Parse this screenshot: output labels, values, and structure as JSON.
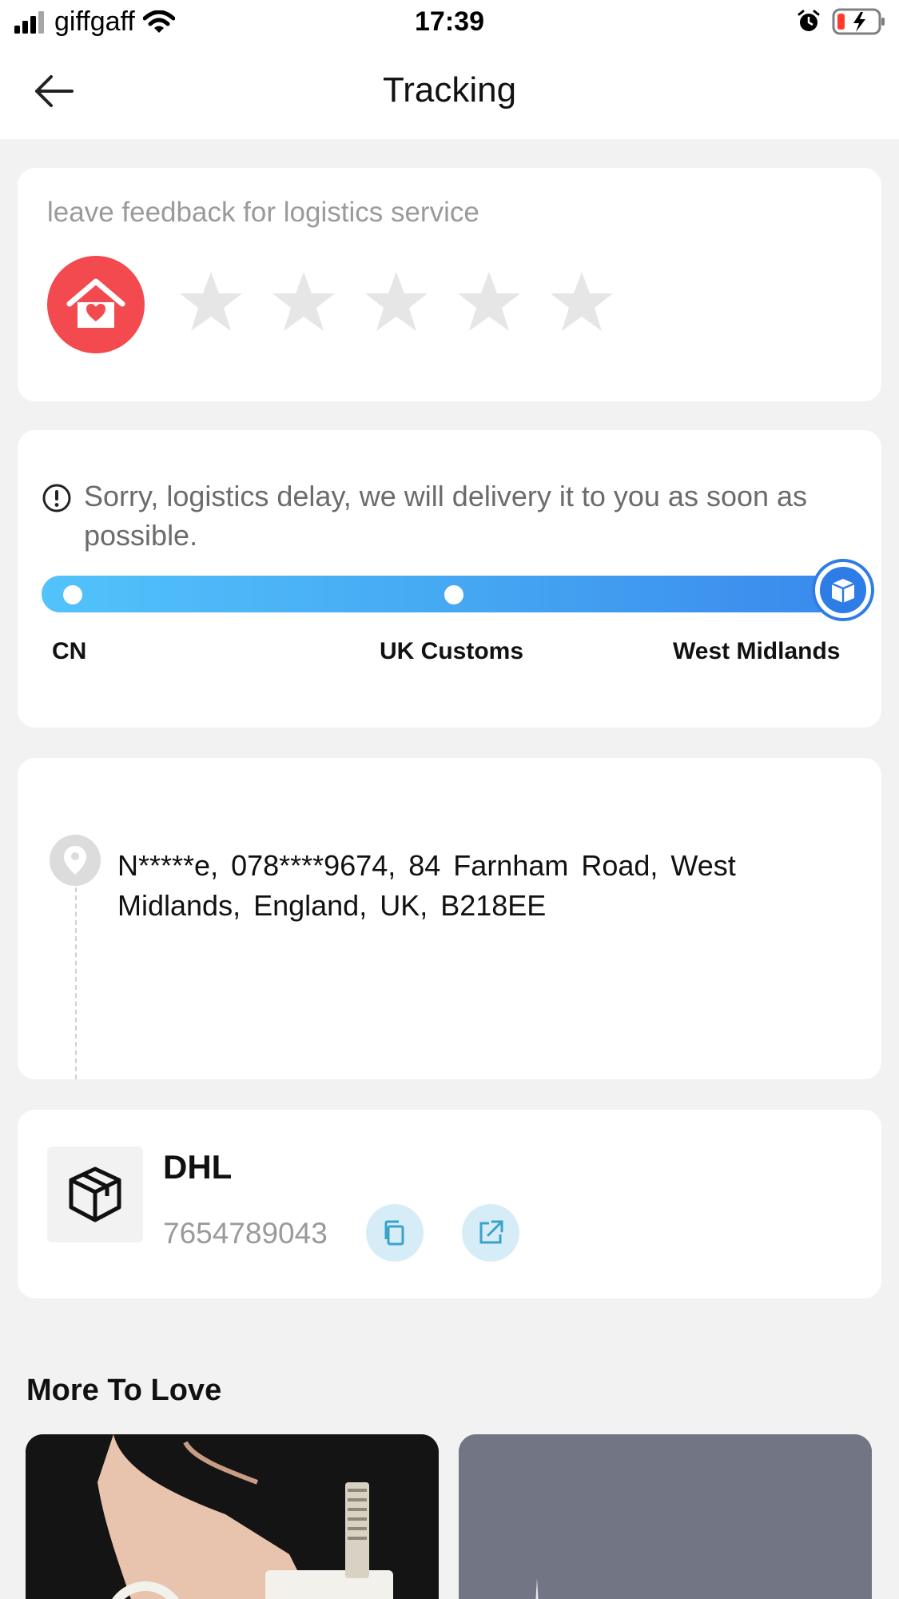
{
  "status_bar": {
    "carrier": "giffgaff",
    "time": "17:39"
  },
  "header": {
    "title": "Tracking"
  },
  "feedback": {
    "prompt": "leave feedback for logistics service",
    "rating": 0,
    "max_rating": 5
  },
  "delay": {
    "message": "Sorry, logistics delay, we will delivery it to you as soon as possible.",
    "stages": [
      "CN",
      "UK Customs",
      "West Midlands"
    ]
  },
  "address": {
    "text": "N*****e,  078****9674,  84 Farnham Road,  West Midlands,  England,  UK,  B218EE"
  },
  "carrier": {
    "name": "DHL",
    "tracking_number": "7654789043"
  },
  "more_to_love": {
    "title": "More To Love"
  },
  "colors": {
    "accent_red": "#f24a4f",
    "progress_start": "#52c3fb",
    "progress_end": "#3a8aec",
    "button_bg": "#d6edf7",
    "button_icon": "#3aa3c9"
  }
}
